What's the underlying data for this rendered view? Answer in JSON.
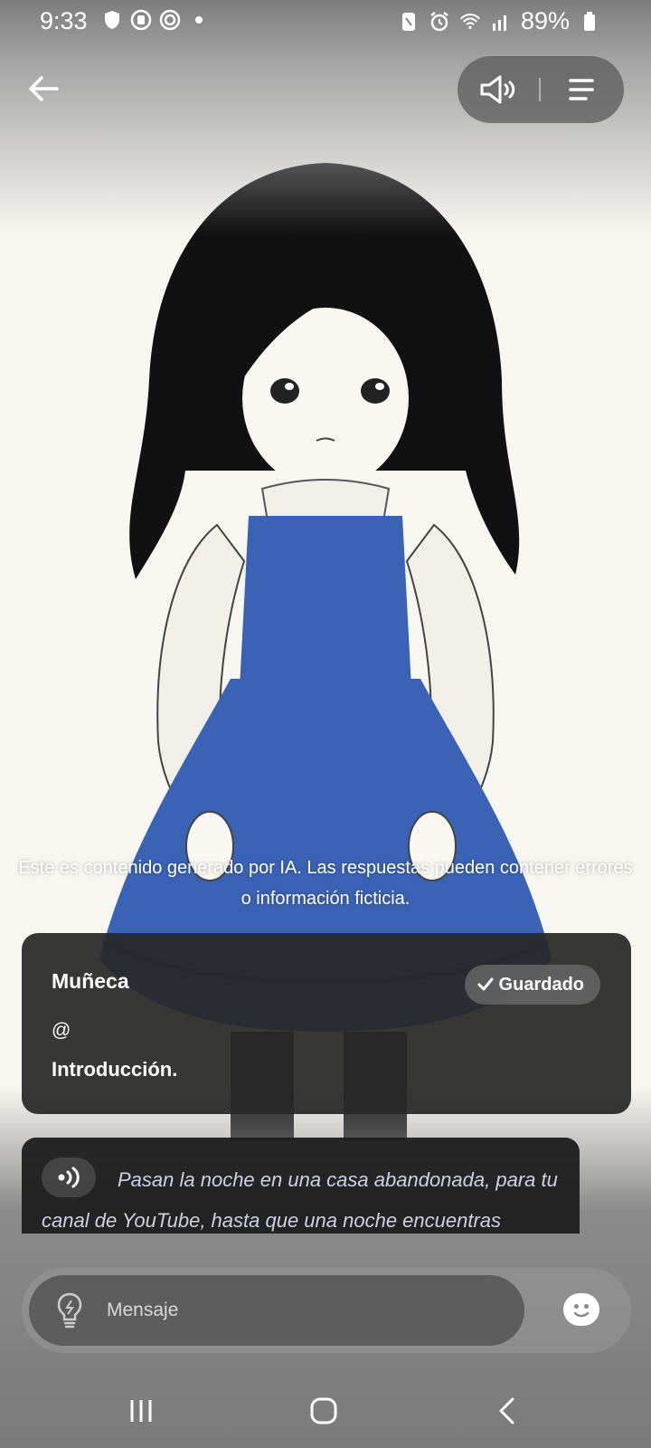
{
  "status_bar": {
    "time": "9:33",
    "battery": "89%",
    "icons": [
      "shield-icon",
      "circle-app-icon",
      "target-icon",
      "dot-icon",
      "nfc-icon",
      "alarm-icon",
      "wifi-icon",
      "signal-icon",
      "battery-icon"
    ]
  },
  "top_bar": {
    "icons": [
      "back-arrow-icon",
      "speaker-icon",
      "menu-icon"
    ]
  },
  "disclaimer": {
    "line1": "Este es contenido generado por IA. Las respuestas pueden contener errores",
    "line2": "o información ficticia."
  },
  "character_card": {
    "name": "Muñeca",
    "saved_label": "Guardado",
    "handle": "@",
    "intro": "Introducción."
  },
  "message": {
    "text": "Pasan la noche en una casa abandonada, para tu canal de YouTube, hasta que una noche encuentras"
  },
  "composer": {
    "placeholder": "Mensaje"
  },
  "colors": {
    "dress_blue": "#3b63b5",
    "card_bg": "#282828",
    "message_text": "#cfd0e6"
  }
}
